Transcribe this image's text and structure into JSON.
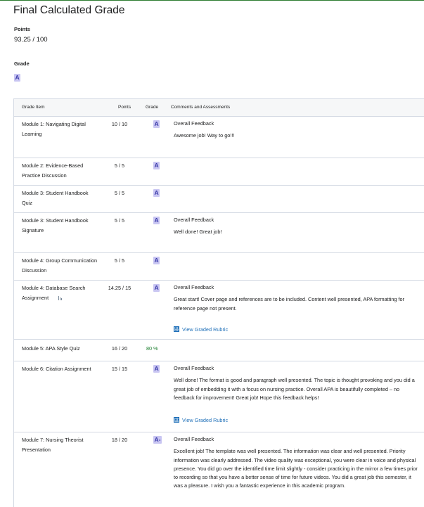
{
  "page": {
    "title": "Final Calculated Grade",
    "points_label": "Points",
    "points_value": "93.25 / 100",
    "grade_label": "Grade",
    "grade_value": "A"
  },
  "table": {
    "headers": {
      "item": "Grade Item",
      "points": "Points",
      "grade": "Grade",
      "comments": "Comments and Assessments"
    },
    "rows": [
      {
        "item": "Module 1: Navigating Digital Learning",
        "points": "10 / 10",
        "grade": "A",
        "feedback_title": "Overall Feedback",
        "feedback": "Awesome job! Way to go!!!"
      },
      {
        "item": "Module 2: Evidence-Based Practice Discussion",
        "points": "5 / 5",
        "grade": "A"
      },
      {
        "item": "Module 3: Student Handbook Quiz",
        "points": "5 / 5",
        "grade": "A"
      },
      {
        "item": "Module 3: Student Handbook Signature",
        "points": "5 / 5",
        "grade": "A",
        "feedback_title": "Overall Feedback",
        "feedback": "Well done! Great job!"
      },
      {
        "item": "Module 4: Group Communication Discussion",
        "points": "5 / 5",
        "grade": "A"
      },
      {
        "item": "Module 4: Database Search Assignment",
        "points": "14.25 / 15",
        "grade": "A",
        "feedback_title": "Overall Feedback",
        "feedback": "Great start! Cover page and references are to be included. Content well presented, APA formatting for reference page not present.",
        "rubric": "View Graded Rubric"
      },
      {
        "item": "Module 5: APA Style Quiz",
        "points": "16 / 20",
        "grade": "80 %"
      },
      {
        "item": "Module 6: Citation Assignment",
        "points": "15 / 15",
        "grade": "A",
        "feedback_title": "Overall Feedback",
        "feedback": "Well done! The format is good and paragraph well presented. The topic is thought provoking and you did a great job of embedding it with a focus on nursing practice. Overall APA is beautifully completed – no feedback for improvement! Great job! Hope this feedback helps!",
        "rubric": "View Graded Rubric"
      },
      {
        "item": "Module 7: Nursing Theorist Presentation",
        "points": "18 / 20",
        "grade": "A-",
        "feedback_title": "Overall Feedback",
        "feedback": "Excellent job! The template was well presented. The information was clear and well presented. Priority information was clearly addressed. The video quality was exceptional, you were clear in voice and physical presence. You did go over the identified time limit slightly - consider practicing in the mirror a few times prior to recording so that you have a better sense of time for future videos. You did a great job this semester, it was a pleasure. I wish you a fantastic experience in this academic program."
      }
    ]
  }
}
